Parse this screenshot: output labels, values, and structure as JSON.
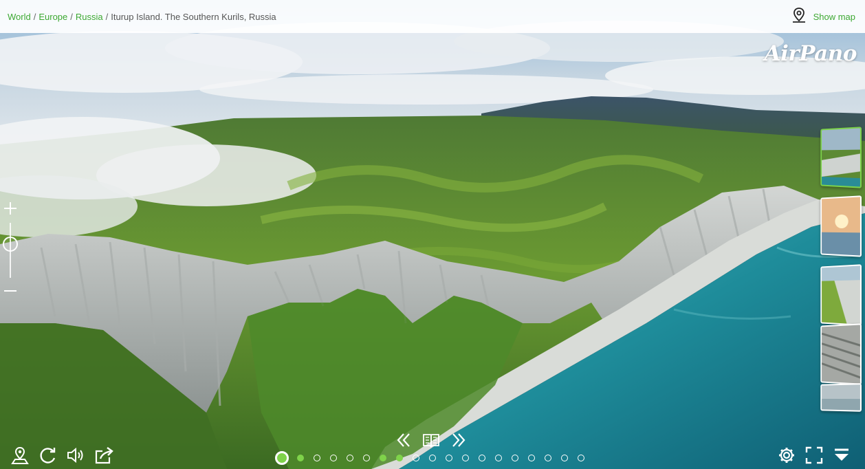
{
  "breadcrumb": {
    "items": [
      "World",
      "Europe",
      "Russia"
    ],
    "separator": "/",
    "current": "Iturup Island. The Southern Kurils, Russia"
  },
  "header": {
    "show_map_label": "Show map",
    "show_map_icon": "map-pin-icon"
  },
  "brand": {
    "logo_text": "AirPano"
  },
  "zoom": {
    "zoom_in_icon": "plus-icon",
    "zoom_out_icon": "minus-icon",
    "level": 0.3
  },
  "thumbnails": {
    "count": 5,
    "active_index": 0
  },
  "bottom_left_controls": [
    "location-icon",
    "rotate-icon",
    "sound-icon",
    "share-icon"
  ],
  "bottom_center_controls": [
    "previous-icon",
    "book-icon",
    "next-icon"
  ],
  "bottom_right_controls": [
    "settings-icon",
    "fullscreen-icon",
    "collapse-icon"
  ],
  "pagination": {
    "total": 19,
    "current": 1,
    "visited": [
      2,
      7,
      8
    ]
  },
  "colors": {
    "accent": "#3da832",
    "active_dot": "#7fd34a",
    "topbar_bg": "#ffffff"
  }
}
